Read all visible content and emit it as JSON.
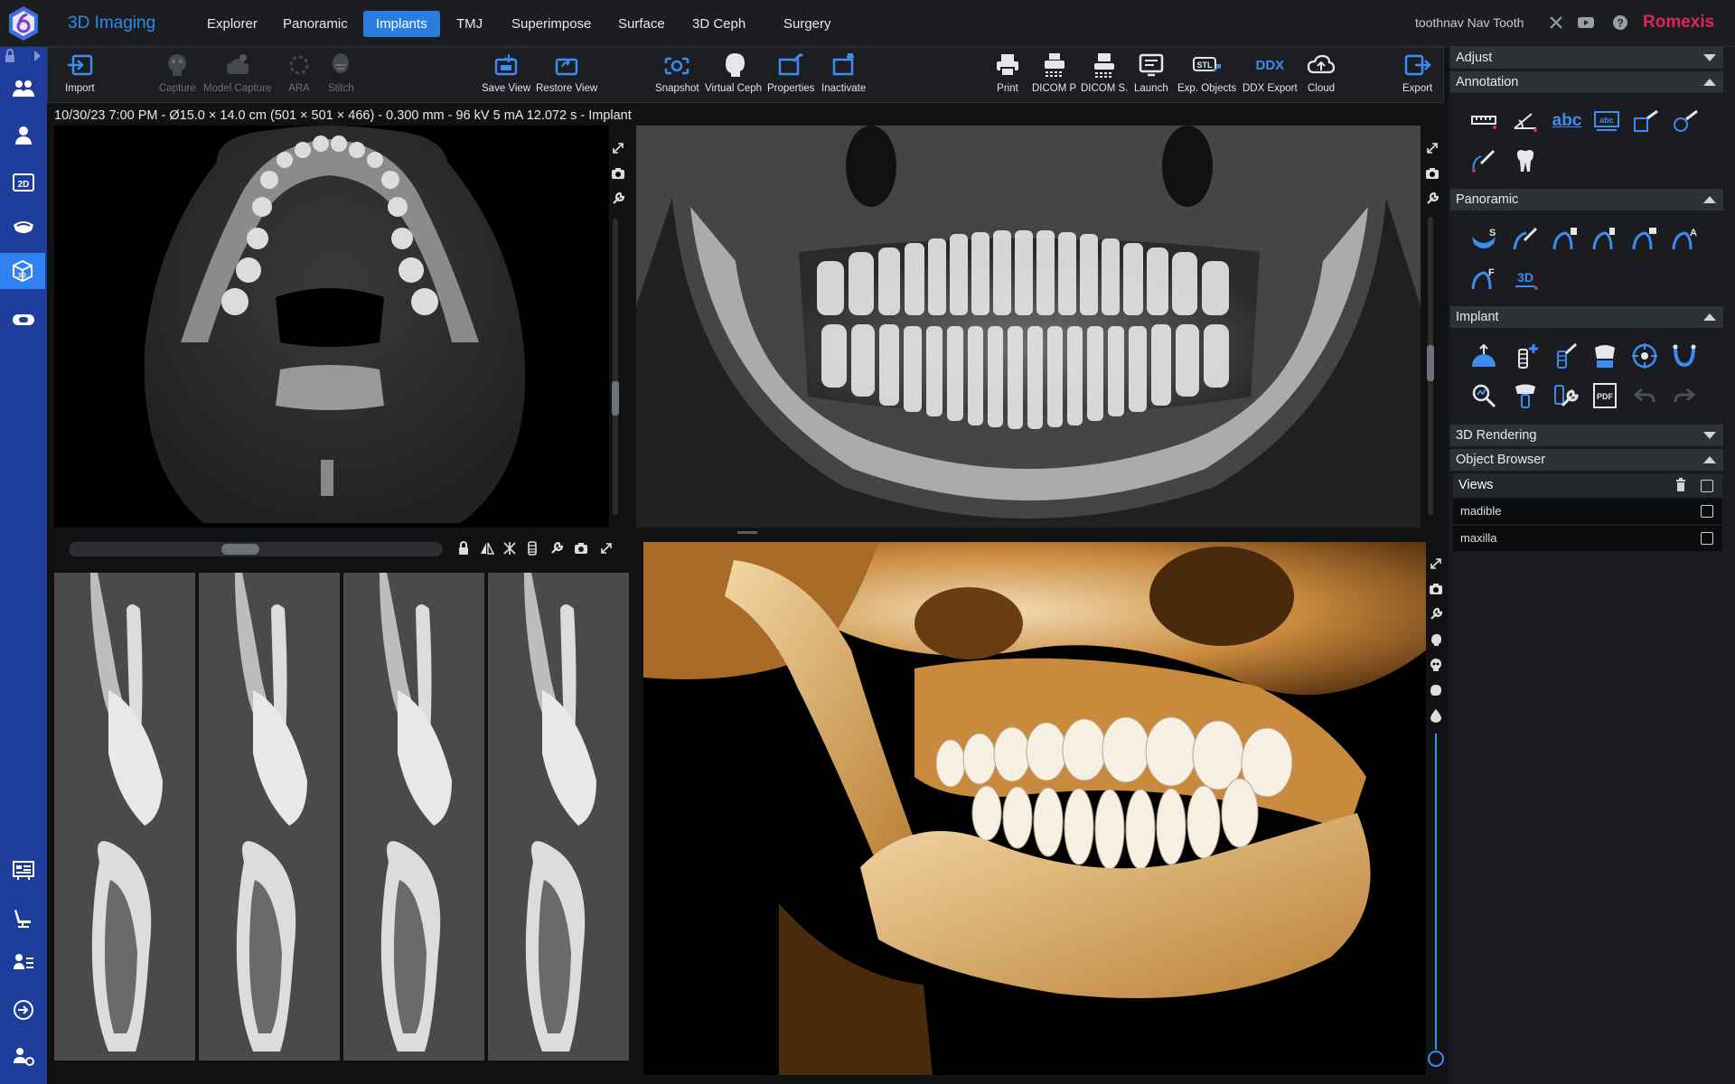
{
  "app": {
    "title": "3D Imaging",
    "user": "toothnav Nav Tooth",
    "brand": "Romexis"
  },
  "nav_tabs": [
    {
      "label": "Explorer",
      "active": false
    },
    {
      "label": "Panoramic",
      "active": false
    },
    {
      "label": "Implants",
      "active": true
    },
    {
      "label": "TMJ",
      "active": false
    },
    {
      "label": "Superimpose",
      "active": false
    },
    {
      "label": "Surface",
      "active": false
    },
    {
      "label": "3D Ceph",
      "active": false
    },
    {
      "label": "Surgery",
      "active": false
    }
  ],
  "toolbar": {
    "import": "Import",
    "capture": "Capture",
    "model_capture": "Model Capture",
    "ara": "ARA",
    "stitch": "Stitch",
    "save_view": "Save View",
    "restore_view": "Restore View",
    "snapshot": "Snapshot",
    "virtual_ceph": "Virtual Ceph",
    "properties": "Properties",
    "inactivate": "Inactivate",
    "print": "Print",
    "dicom_p": "DICOM P",
    "dicom_s": "DICOM S.",
    "launch": "Launch",
    "exp_objects": "Exp. Objects",
    "ddx_export": "DDX Export",
    "cloud": "Cloud",
    "export": "Export",
    "ddx_icon_text": "DDX",
    "stl_icon_text": "STL"
  },
  "info": "10/30/23 7:00 PM - Ø15.0 × 14.0 cm (501 × 501 × 466) - 0.300 mm - 96 kV 5 mA 12.072 s - Implant",
  "right_panel": {
    "adjust": "Adjust",
    "annotation": "Annotation",
    "panoramic": "Panoramic",
    "implant": "Implant",
    "rendering": "3D Rendering",
    "object_browser": "Object Browser",
    "views": "Views",
    "objects": [
      {
        "name": "madible"
      },
      {
        "name": "maxilla"
      }
    ],
    "abc_text": "abc",
    "pdf_text": "PDF",
    "threed_text": "3D",
    "pano_letters": {
      "s": "S",
      "a": "A",
      "f": "F"
    }
  },
  "colors": {
    "accent": "#2b7ce0",
    "sidebar": "#1f3d9a",
    "brand": "#e0245e",
    "bone": "#d9a05a"
  }
}
